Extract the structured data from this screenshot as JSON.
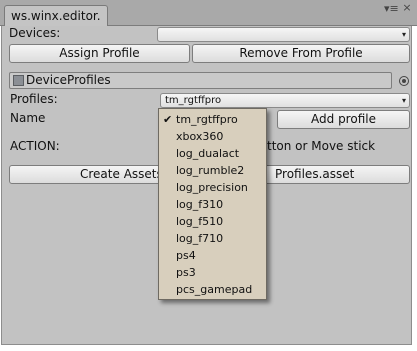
{
  "window": {
    "tab_title": "ws.winx.editor.",
    "menu_glyph": "▾≡",
    "close_glyph": "×"
  },
  "devices": {
    "label": "Devices:",
    "value": ""
  },
  "buttons": {
    "assign_profile": "Assign Profile",
    "remove_from_profile": "Remove From Profile",
    "add_profile": "Add profile",
    "create_assets_left": "Create Assets",
    "create_assets_right": "Profiles.asset"
  },
  "device_profiles_field": {
    "value": "DeviceProfiles"
  },
  "profiles": {
    "label": "Profiles:",
    "selected": "tm_rgtffpro"
  },
  "name": {
    "label": "Name"
  },
  "action": {
    "label": "ACTION:",
    "hint": "tton or Move stick"
  },
  "dropdown": {
    "options": [
      {
        "label": "tm_rgtffpro",
        "checked": true
      },
      {
        "label": "xbox360",
        "checked": false
      },
      {
        "label": "log_dualact",
        "checked": false
      },
      {
        "label": "log_rumble2",
        "checked": false
      },
      {
        "label": "log_precision",
        "checked": false
      },
      {
        "label": "log_f310",
        "checked": false
      },
      {
        "label": "log_f510",
        "checked": false
      },
      {
        "label": "log_f710",
        "checked": false
      },
      {
        "label": "ps4",
        "checked": false
      },
      {
        "label": "ps3",
        "checked": false
      },
      {
        "label": "pcs_gamepad",
        "checked": false
      }
    ],
    "check_glyph": "✔"
  },
  "icons": {
    "caret": "▾",
    "object_field_icon": "scriptable-object-icon",
    "picker_icon": "object-picker-icon"
  },
  "colors": {
    "panel": "#c2c2c2",
    "dropdown_bg": "#d8cfbd",
    "tabstrip": "#a9a9a9"
  }
}
